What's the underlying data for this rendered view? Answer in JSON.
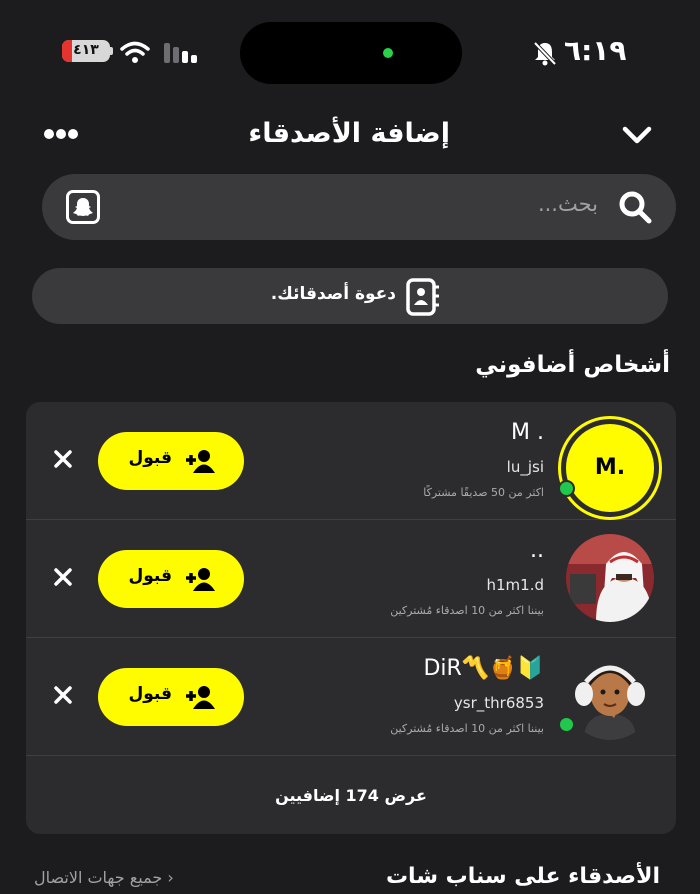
{
  "status_bar": {
    "time": "٦:١٩",
    "battery": "٤١٣",
    "battery_color": "#e5342e",
    "icons": [
      "wifi-icon",
      "signal-icon",
      "mute-bell-icon"
    ]
  },
  "header": {
    "title": "إضافة الأصدقاء",
    "left_icon": "more-icon",
    "right_icon": "chevron-down-icon"
  },
  "search": {
    "placeholder": "بحث...",
    "icon": "search-icon",
    "scan_icon": "snapchat-ghost-icon"
  },
  "invite": {
    "label": "دعوة أصدقائك.",
    "icon": "contacts-book-icon"
  },
  "added_me": {
    "title": "أشخاص أضافوني",
    "accept_label": "قبول",
    "accept_color": "#fffc00",
    "requests": [
      {
        "display_name": "M .",
        "username": "lu_jsi",
        "mutual": "اكثر من 50 صديقًا مشتركًا",
        "avatar_text": "M.",
        "online": true
      },
      {
        "display_name": "..",
        "username": "h1m1.d",
        "mutual": "بيننا اكثر من 10 اصدقاء مُشتركين",
        "online": false
      },
      {
        "display_name": "DiR〽️🍯🔰",
        "username": "ysr_thr6853",
        "mutual": "بيننا اكثر من 10 اصدقاء مُشتركين",
        "online": true
      }
    ],
    "show_more": "عرض 174 إضافيين"
  },
  "bottom": {
    "section_title": "الأصدقاء على سناب شات",
    "all_contacts": "جميع جهات الاتصال"
  }
}
